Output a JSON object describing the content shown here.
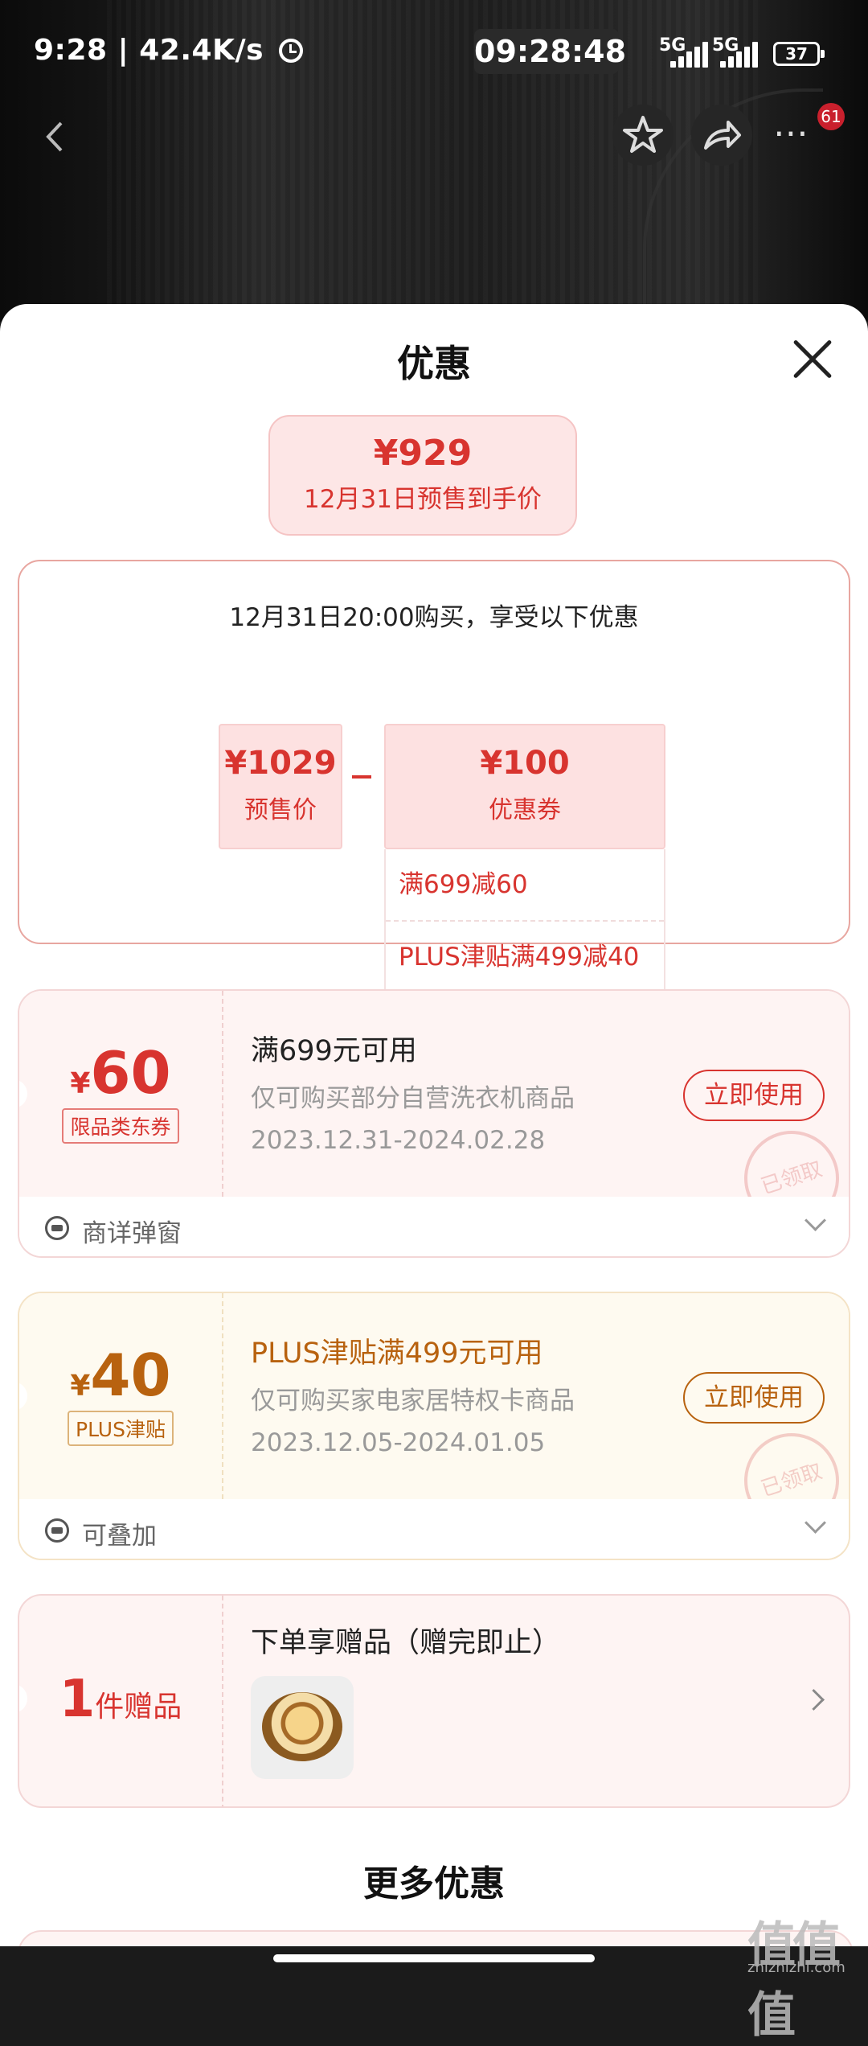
{
  "status_bar": {
    "left": "9:28 | 42.4K/s",
    "time": "09:28:48",
    "net1": "5G",
    "net2": "5G",
    "battery": "37"
  },
  "nav": {
    "badge": "61",
    "more": "⋯"
  },
  "sheet": {
    "title": "优惠"
  },
  "summary": {
    "price": "¥929",
    "price_label": "12月31日预售到手价",
    "headline": "12月31日20:00购买，享受以下优惠",
    "presale_value": "¥1029",
    "presale_label": "预售价",
    "coupon_value": "¥100",
    "coupon_label": "优惠券",
    "coupon_items": [
      "满699减60",
      "PLUS津贴满499减40"
    ]
  },
  "coupons": [
    {
      "currency": "¥",
      "amount": "60",
      "tag": "限品类东券",
      "title": "满699元可用",
      "desc": "仅可购买部分自营洗衣机商品",
      "period": "2023.12.31-2024.02.28",
      "button": "立即使用",
      "stamp": "已领取",
      "footer": "商详弹窗",
      "accent": "#d8342f"
    },
    {
      "currency": "¥",
      "amount": "40",
      "tag": "PLUS津贴",
      "title": "PLUS津贴满499元可用",
      "desc": "仅可购买家电家居特权卡商品",
      "period": "2023.12.05-2024.01.05",
      "button": "立即使用",
      "stamp": "已领取",
      "footer": "可叠加",
      "accent": "#b8620f"
    }
  ],
  "gift": {
    "count": "1",
    "unit": "件赠品",
    "title": "下单享赠品（赠完即止）"
  },
  "more": {
    "title": "更多优惠"
  },
  "watermark": {
    "main": "值值值",
    "sub": "zhizhizhi.com"
  }
}
